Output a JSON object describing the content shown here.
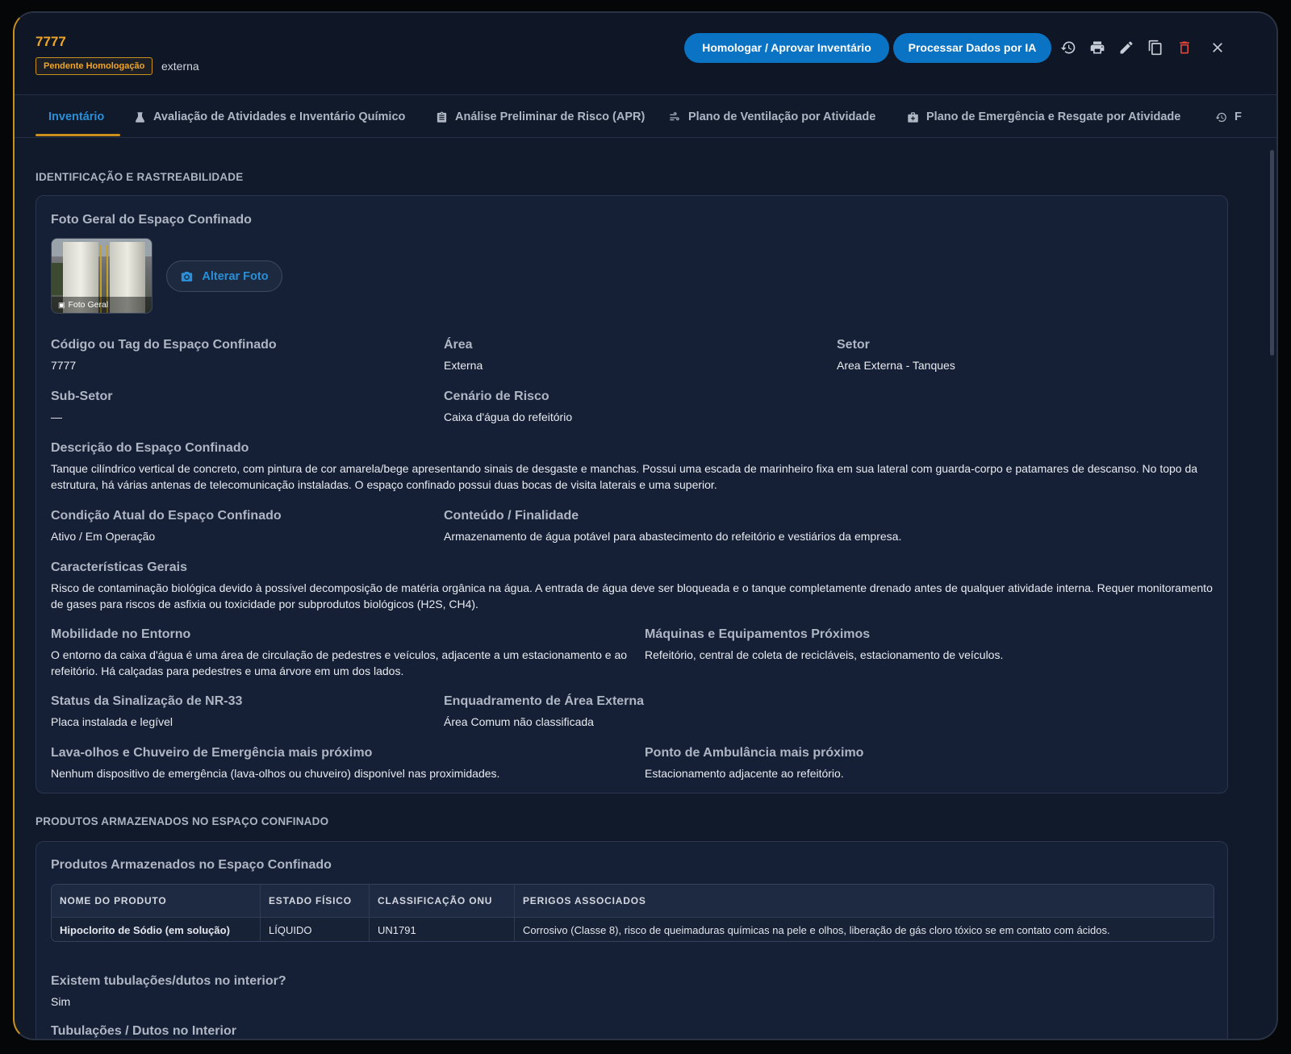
{
  "header": {
    "code": "7777",
    "status_badge": "Pendente Homologação",
    "area": "externa",
    "homologate_button": "Homologar / Aprovar Inventário",
    "process_ai_button": "Processar Dados por IA",
    "icons": [
      "history-icon",
      "print-icon",
      "edit-icon",
      "copy-icon",
      "delete-icon",
      "close-icon"
    ],
    "delete_color": "#e0443a"
  },
  "tabs": [
    {
      "label": "Inventário",
      "icon": "",
      "active": true
    },
    {
      "label": "Avaliação de Atividades e Inventário Químico",
      "icon": "flask-icon"
    },
    {
      "label": "Análise Preliminar de Risco (APR)",
      "icon": "clipboard-icon"
    },
    {
      "label": "Plano de Ventilação por Atividade",
      "icon": "wind-icon"
    },
    {
      "label": "Plano de Emergência e Resgate por Atividade",
      "icon": "medkit-icon"
    },
    {
      "label": "F",
      "icon": "history-icon"
    }
  ],
  "identification": {
    "section_title": "IDENTIFICAÇÃO E RASTREABILIDADE",
    "photo_heading": "Foto Geral do Espaço Confinado",
    "photo_caption": "Foto Geral",
    "change_photo_button": "Alterar Foto",
    "fields": {
      "code_label": "Código ou Tag do Espaço Confinado",
      "code_value": "7777",
      "area_label": "Área",
      "area_value": "Externa",
      "sector_label": "Setor",
      "sector_value": "Area Externa - Tanques",
      "subsector_label": "Sub-Setor",
      "subsector_value": "—",
      "risk_scenario_label": "Cenário de Risco",
      "risk_scenario_value": "Caixa d'água do refeitório",
      "description_label": "Descrição do Espaço Confinado",
      "description_value": "Tanque cilíndrico vertical de concreto, com pintura de cor amarela/bege apresentando sinais de desgaste e manchas. Possui uma escada de marinheiro fixa em sua lateral com guarda-corpo e patamares de descanso. No topo da estrutura, há várias antenas de telecomunicação instaladas. O espaço confinado possui duas bocas de visita laterais e uma superior.",
      "condition_label": "Condição Atual do Espaço Confinado",
      "condition_value": "Ativo / Em Operação",
      "content_label": "Conteúdo / Finalidade",
      "content_value": "Armazenamento de água potável para abastecimento do refeitório e vestiários da empresa.",
      "features_label": "Características Gerais",
      "features_value": "Risco de contaminação biológica devido à possível decomposição de matéria orgânica na água. A entrada de água deve ser bloqueada e o tanque completamente drenado antes de qualquer atividade interna. Requer monitoramento de gases para riscos de asfixia ou toxicidade por subprodutos biológicos (H2S, CH4).",
      "mobility_label": "Mobilidade no Entorno",
      "mobility_value": "O entorno da caixa d'água é uma área de circulação de pedestres e veículos, adjacente a um estacionamento e ao refeitório. Há calçadas para pedestres e uma árvore em um dos lados.",
      "machines_label": "Máquinas e Equipamentos Próximos",
      "machines_value": "Refeitório, central de coleta de recicláveis, estacionamento de veículos.",
      "signage_label": "Status da Sinalização de NR-33",
      "signage_value": "Placa instalada e legível",
      "external_area_label": "Enquadramento de Área Externa",
      "external_area_value": "Área Comum não classificada",
      "eyewash_label": "Lava-olhos e Chuveiro de Emergência mais próximo",
      "eyewash_value": "Nenhum dispositivo de emergência (lava-olhos ou chuveiro) disponível nas proximidades.",
      "ambulance_label": "Ponto de Ambulância mais próximo",
      "ambulance_value": "Estacionamento adjacente ao refeitório."
    }
  },
  "products": {
    "section_title": "PRODUTOS ARMAZENADOS NO ESPAÇO CONFINADO",
    "card_heading": "Produtos Armazenados no Espaço Confinado",
    "columns": [
      "NOME DO PRODUTO",
      "ESTADO FÍSICO",
      "CLASSIFICAÇÃO ONU",
      "PERIGOS ASSOCIADOS"
    ],
    "rows": [
      [
        "Hipoclorito de Sódio (em solução)",
        "LÍQUIDO",
        "UN1791",
        "Corrosivo (Classe 8), risco de queimaduras químicas na pele e olhos, liberação de gás cloro tóxico se em contato com ácidos."
      ]
    ],
    "pipes_label": "Existem tubulações/dutos no interior?",
    "pipes_value": "Sim",
    "pipes_next_label": "Tubulações / Dutos no Interior"
  },
  "colors": {
    "accent_orange": "#f0a527",
    "accent_blue": "#0b73c4",
    "link_blue": "#2a8fd6",
    "background": "#111a2b"
  }
}
